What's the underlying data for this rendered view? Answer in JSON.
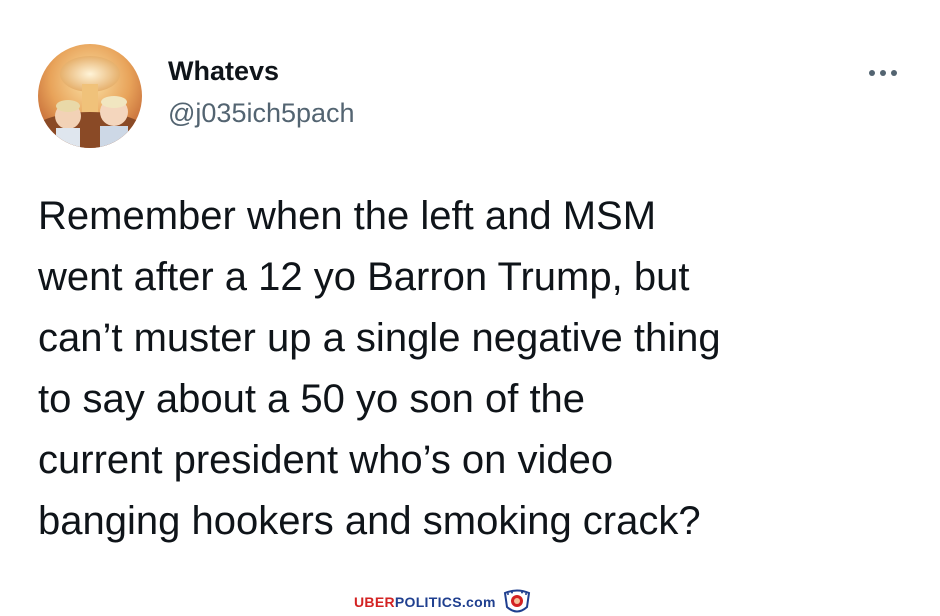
{
  "tweet": {
    "display_name": "Whatevs",
    "handle": "@j035ich5pach",
    "more_icon": "more-horizontal-icon",
    "text_lines": [
      "Remember when the left and MSM",
      "went after a 12 yo Barron Trump, but",
      "can’t muster up a single negative thing",
      "to say about a 50 yo son of the",
      "current president who’s on video",
      "banging hookers and smoking crack?"
    ]
  },
  "watermark": {
    "brand_red": "UBER",
    "brand_blue": "POLITICS.com",
    "logo_icon": "lion-crest-icon"
  },
  "colors": {
    "text_primary": "#0f1419",
    "text_secondary": "#536471",
    "brand_red": "#d32222",
    "brand_blue": "#1f3f8f"
  }
}
